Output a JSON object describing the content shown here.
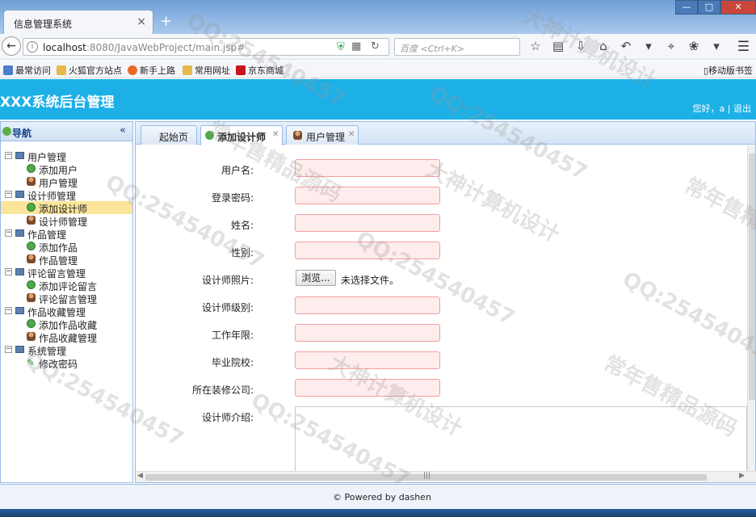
{
  "browser": {
    "tab_title": "信息管理系统",
    "tab_close": "×",
    "new_tab": "+",
    "url_host": "localhost",
    "url_path": ":8080/JavaWebProject/main.jsp#",
    "search_placeholder": "百度 <Ctrl+K>",
    "bookmarks": [
      "最常访问",
      "火狐官方站点",
      "新手上路",
      "常用网址",
      "京东商城"
    ],
    "mobile_bookmarks": "移动版书签",
    "window_buttons": [
      "—",
      "□",
      "✕"
    ]
  },
  "header": {
    "title": "XXX系统后台管理",
    "user_greeting": "您好，a | 退出"
  },
  "sidebar": {
    "title": "导航",
    "collapse_glyph": "«",
    "groups": [
      {
        "label": "用户管理",
        "items": [
          "添加用户",
          "用户管理"
        ]
      },
      {
        "label": "设计师管理",
        "items": [
          "添加设计师",
          "设计师管理"
        ]
      },
      {
        "label": "作品管理",
        "items": [
          "添加作品",
          "作品管理"
        ]
      },
      {
        "label": "评论留言管理",
        "items": [
          "添加评论留言",
          "评论留言管理"
        ]
      },
      {
        "label": "作品收藏管理",
        "items": [
          "添加作品收藏",
          "作品收藏管理"
        ]
      },
      {
        "label": "系统管理",
        "items": [
          "修改密码"
        ]
      }
    ],
    "selected": "添加设计师"
  },
  "tabs": [
    {
      "label": "起始页",
      "closable": false
    },
    {
      "label": "添加设计师",
      "closable": true,
      "active": true
    },
    {
      "label": "用户管理",
      "closable": true
    }
  ],
  "form": {
    "fields": [
      {
        "label": "用户名:",
        "value": ""
      },
      {
        "label": "登录密码:",
        "value": ""
      },
      {
        "label": "姓名:",
        "value": ""
      },
      {
        "label": "性别:",
        "value": ""
      },
      {
        "label": "设计师照片:",
        "type": "file",
        "button": "浏览...",
        "status": "未选择文件。"
      },
      {
        "label": "设计师级别:",
        "value": ""
      },
      {
        "label": "工作年限:",
        "value": ""
      },
      {
        "label": "毕业院校:",
        "value": ""
      },
      {
        "label": "所在装修公司:",
        "value": ""
      },
      {
        "label": "设计师介绍:",
        "type": "textarea",
        "value": ""
      }
    ]
  },
  "footer": {
    "text": "© Powered by dashen"
  },
  "watermarks": [
    "QQ:254540457",
    "大神计算机设计",
    "常年售精品源码"
  ]
}
